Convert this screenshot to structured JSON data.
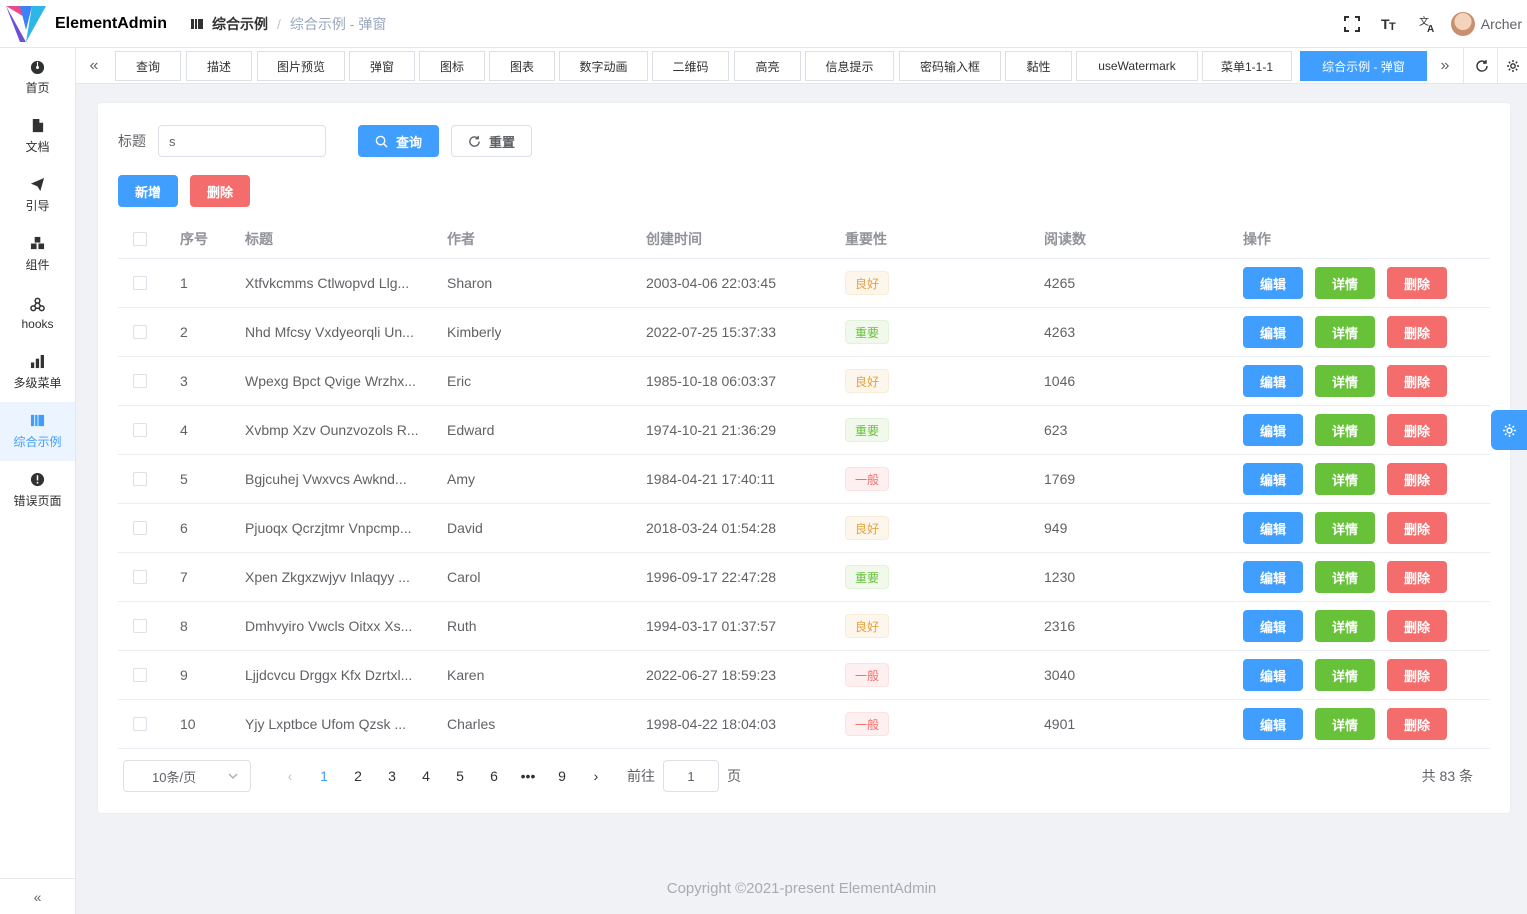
{
  "app": {
    "name": "ElementAdmin"
  },
  "breadcrumb": {
    "first": "综合示例",
    "last": "综合示例 - 弹窗"
  },
  "header": {
    "user_name": "Archer",
    "icons": [
      "fullscreen-icon",
      "font-size-icon",
      "translate-icon"
    ]
  },
  "sidebar": {
    "items": [
      {
        "label": "首页",
        "icon": "dashboard-icon"
      },
      {
        "label": "文档",
        "icon": "document-icon"
      },
      {
        "label": "引导",
        "icon": "paper-plane-icon"
      },
      {
        "label": "组件",
        "icon": "cubes-icon"
      },
      {
        "label": "hooks",
        "icon": "share-nodes-icon"
      },
      {
        "label": "多级菜单",
        "icon": "bar-chart-icon"
      },
      {
        "label": "综合示例",
        "icon": "book-icon",
        "active": true
      },
      {
        "label": "错误页面",
        "icon": "error-icon"
      }
    ]
  },
  "tags": [
    "查询",
    "描述",
    "图片预览",
    "弹窗",
    "图标",
    "图表",
    "数字动画",
    "二维码",
    "高亮",
    "信息提示",
    "密码输入框",
    "黏性",
    "useWatermark",
    "菜单1-1-1",
    "综合示例 - 弹窗"
  ],
  "active_tag_index": 14,
  "search": {
    "label": "标题",
    "value": "s",
    "query_button": "查询",
    "reset_button": "重置"
  },
  "actions": {
    "add": "新增",
    "delete": "删除"
  },
  "table": {
    "columns": [
      "序号",
      "标题",
      "作者",
      "创建时间",
      "重要性",
      "阅读数",
      "操作"
    ],
    "rows": [
      {
        "id": "1",
        "title": "Xtfvkcmms Ctlwopvd Llg...",
        "author": "Sharon",
        "time": "2003-04-06 22:03:45",
        "importance": "良好",
        "imp_type": "warning",
        "reads": "4265"
      },
      {
        "id": "2",
        "title": "Nhd Mfcsy Vxdyeorqli Un...",
        "author": "Kimberly",
        "time": "2022-07-25 15:37:33",
        "importance": "重要",
        "imp_type": "success",
        "reads": "4263"
      },
      {
        "id": "3",
        "title": "Wpexg Bpct Qvige Wrzhx...",
        "author": "Eric",
        "time": "1985-10-18 06:03:37",
        "importance": "良好",
        "imp_type": "warning",
        "reads": "1046"
      },
      {
        "id": "4",
        "title": "Xvbmp Xzv Ounzvozols R...",
        "author": "Edward",
        "time": "1974-10-21 21:36:29",
        "importance": "重要",
        "imp_type": "success",
        "reads": "623"
      },
      {
        "id": "5",
        "title": "Bgjcuhej Vwxvcs Awknd...",
        "author": "Amy",
        "time": "1984-04-21 17:40:11",
        "importance": "一般",
        "imp_type": "danger",
        "reads": "1769"
      },
      {
        "id": "6",
        "title": "Pjuoqx Qcrzjtmr Vnpcmp...",
        "author": "David",
        "time": "2018-03-24 01:54:28",
        "importance": "良好",
        "imp_type": "warning",
        "reads": "949"
      },
      {
        "id": "7",
        "title": "Xpen Zkgxzwjyv Inlaqyy ...",
        "author": "Carol",
        "time": "1996-09-17 22:47:28",
        "importance": "重要",
        "imp_type": "success",
        "reads": "1230"
      },
      {
        "id": "8",
        "title": "Dmhvyiro Vwcls Oitxx Xs...",
        "author": "Ruth",
        "time": "1994-03-17 01:37:57",
        "importance": "良好",
        "imp_type": "warning",
        "reads": "2316"
      },
      {
        "id": "9",
        "title": "Ljjdcvcu Drggx Kfx Dzrtxl...",
        "author": "Karen",
        "time": "2022-06-27 18:59:23",
        "importance": "一般",
        "imp_type": "danger",
        "reads": "3040"
      },
      {
        "id": "10",
        "title": "Yjy Lxptbce Ufom Qzsk ...",
        "author": "Charles",
        "time": "1998-04-22 18:04:03",
        "importance": "一般",
        "imp_type": "danger",
        "reads": "4901"
      }
    ],
    "row_actions": {
      "edit": "编辑",
      "detail": "详情",
      "delete": "删除"
    }
  },
  "pagination": {
    "page_size": "10条/页",
    "pages": [
      "1",
      "2",
      "3",
      "4",
      "5",
      "6",
      "•••",
      "9"
    ],
    "current": "1",
    "goto_label": "前往",
    "goto_value": "1",
    "goto_suffix": "页",
    "total": "共 83 条"
  },
  "footer": {
    "copyright": "Copyright ©2021-present ElementAdmin"
  },
  "colors": {
    "primary": "#409eff",
    "success": "#67c23a",
    "danger": "#f56c6c",
    "warning": "#e6a23c"
  }
}
